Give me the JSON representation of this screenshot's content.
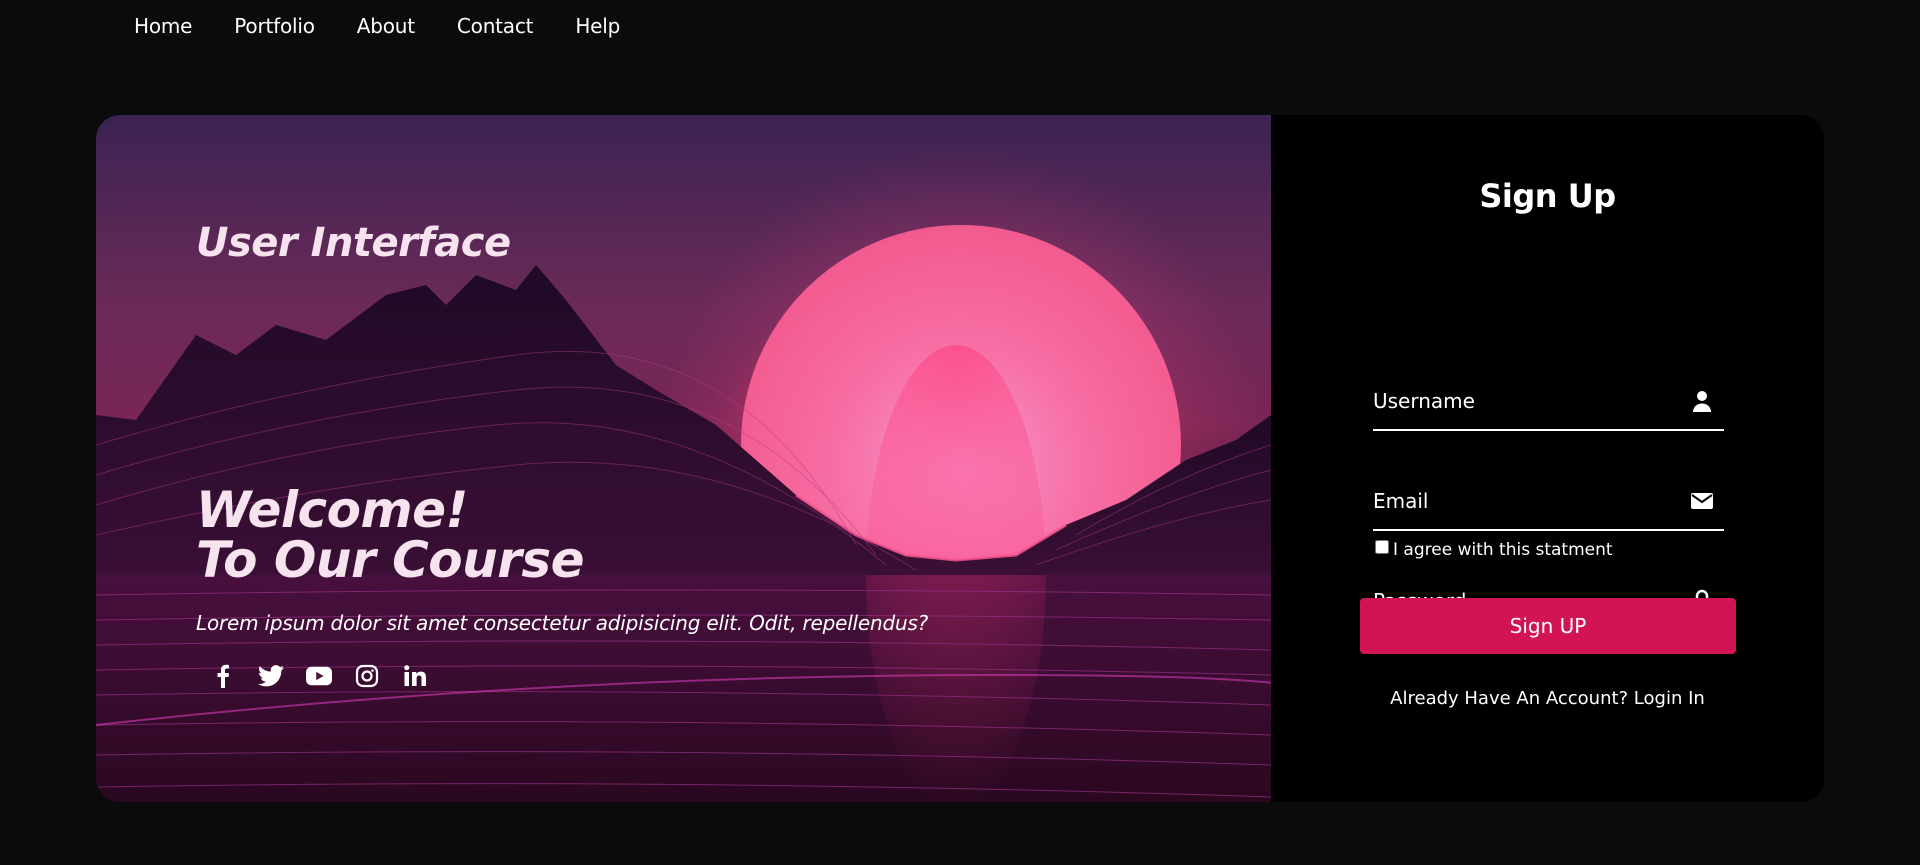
{
  "nav": {
    "items": [
      {
        "label": "Home"
      },
      {
        "label": "Portfolio"
      },
      {
        "label": "About"
      },
      {
        "label": "Contact"
      },
      {
        "label": "Help"
      }
    ]
  },
  "hero": {
    "title": "User Interface",
    "welcome_line1": "Welcome!",
    "welcome_line2": "To Our Course",
    "description": "Lorem ipsum dolor sit amet consectetur adipisicing elit. Odit, repellendus?",
    "socials": [
      "facebook-icon",
      "twitter-icon",
      "youtube-icon",
      "instagram-icon",
      "linkedin-icon"
    ]
  },
  "form": {
    "title": "Sign Up",
    "username_placeholder": "Username",
    "email_placeholder": "Email",
    "password_placeholder": "Password",
    "agree_label": "I agree with this statment",
    "submit_label": "Sign UP",
    "login_link": "Already Have An Account? Login In",
    "icons": {
      "username": "user-icon",
      "email": "envelope-icon",
      "password": "lock-icon"
    }
  },
  "colors": {
    "background": "#0b0b0b",
    "accent": "#d21456",
    "sun": "#f7679a"
  }
}
